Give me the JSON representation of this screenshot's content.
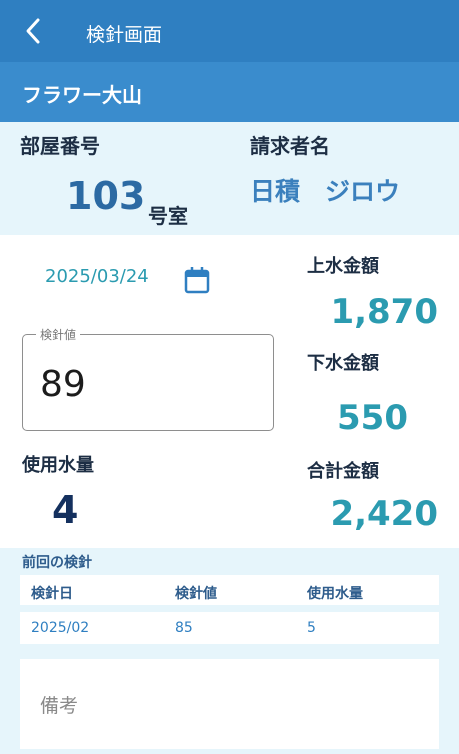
{
  "header": {
    "title": "検針画面",
    "back_icon": "chevron-left-icon"
  },
  "building": {
    "name": "フラワー大山"
  },
  "room": {
    "label": "部屋番号",
    "number": "103",
    "suffix": "号室"
  },
  "customer": {
    "label": "請求者名",
    "name": "日積　ジロウ"
  },
  "reading": {
    "date": "2025/03/24",
    "calendar_icon": "calendar-icon",
    "input_label": "検針値",
    "input_value": "89"
  },
  "usage": {
    "label": "使用水量",
    "value": "4"
  },
  "fees": {
    "water_label": "上水金額",
    "water_value": "1,870",
    "sewer_label": "下水金額",
    "sewer_value": "550",
    "total_label": "合計金額",
    "total_value": "2,420"
  },
  "previous": {
    "title": "前回の検針",
    "headers": [
      "検針日",
      "検針値",
      "使用水量"
    ],
    "row": [
      "2025/02",
      "85",
      "5"
    ]
  },
  "notes": {
    "placeholder": "備考"
  },
  "colors": {
    "header": "#2f7fc1",
    "subheader": "#3a8ccd",
    "accent": "#2b9bb0",
    "background": "#e6f5fb"
  }
}
